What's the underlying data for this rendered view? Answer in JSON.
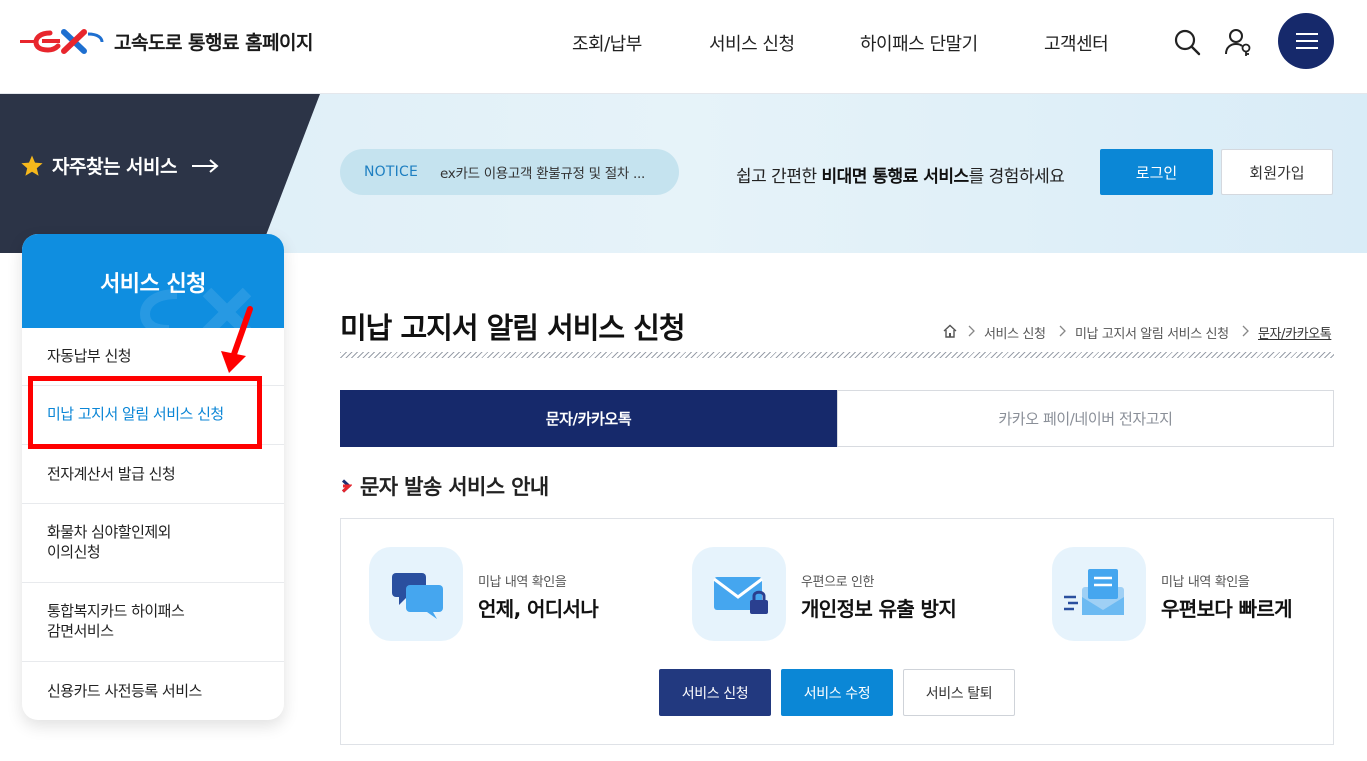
{
  "header": {
    "logo_mark": "ex",
    "site_title": "고속도로 통행료 홈페이지",
    "nav": [
      "조회/납부",
      "서비스 신청",
      "하이패스 단말기",
      "고객센터"
    ],
    "icons": [
      "search-icon",
      "user-icon",
      "menu-icon"
    ]
  },
  "banner": {
    "favorites_label": "자주찾는 서비스",
    "notice_tag": "NOTICE",
    "notice_text": "ex카드 이용고객 환불규정 및 절차 ...",
    "message_before": "쉽고 간편한 ",
    "message_bold": "비대면 통행료 서비스",
    "message_after": "를 경험하세요",
    "login_label": "로그인",
    "join_label": "회원가입"
  },
  "side_menu": {
    "title": "서비스 신청",
    "items": [
      {
        "line1": "자동납부 신청",
        "line2": ""
      },
      {
        "line1": "미납 고지서 알림 서비스 신청",
        "line2": ""
      },
      {
        "line1": "전자계산서 발급 신청",
        "line2": ""
      },
      {
        "line1": "화물차 심야할인제외",
        "line2": "이의신청"
      },
      {
        "line1": "통합복지카드 하이패스",
        "line2": "감면서비스"
      },
      {
        "line1": "신용카드 사전등록 서비스",
        "line2": ""
      }
    ],
    "active_index": 1
  },
  "main": {
    "page_title": "미납 고지서 알림 서비스 신청",
    "breadcrumb": [
      "서비스 신청",
      "미납 고지서 알림 서비스 신청",
      "문자/카카오톡"
    ],
    "tabs": [
      "문자/카카오톡",
      "카카오 페이/네이버 전자고지"
    ],
    "section_title": "문자 발송 서비스 안내",
    "features": [
      {
        "icon": "chat-bubbles-icon",
        "sub": "미납 내역 확인을",
        "main": "언제, 어디서나"
      },
      {
        "icon": "mail-lock-icon",
        "sub": "우편으로 인한",
        "main": "개인정보 유출 방지"
      },
      {
        "icon": "fast-mail-icon",
        "sub": "미납 내역 확인을",
        "main": "우편보다 빠르게"
      }
    ],
    "buttons": [
      "서비스 신청",
      "서비스 수정",
      "서비스 탈퇴"
    ]
  },
  "colors": {
    "navy": "#16296b",
    "blue": "#0b87d6",
    "side_head": "#0f8ee0",
    "highlight": "#ff0000"
  }
}
